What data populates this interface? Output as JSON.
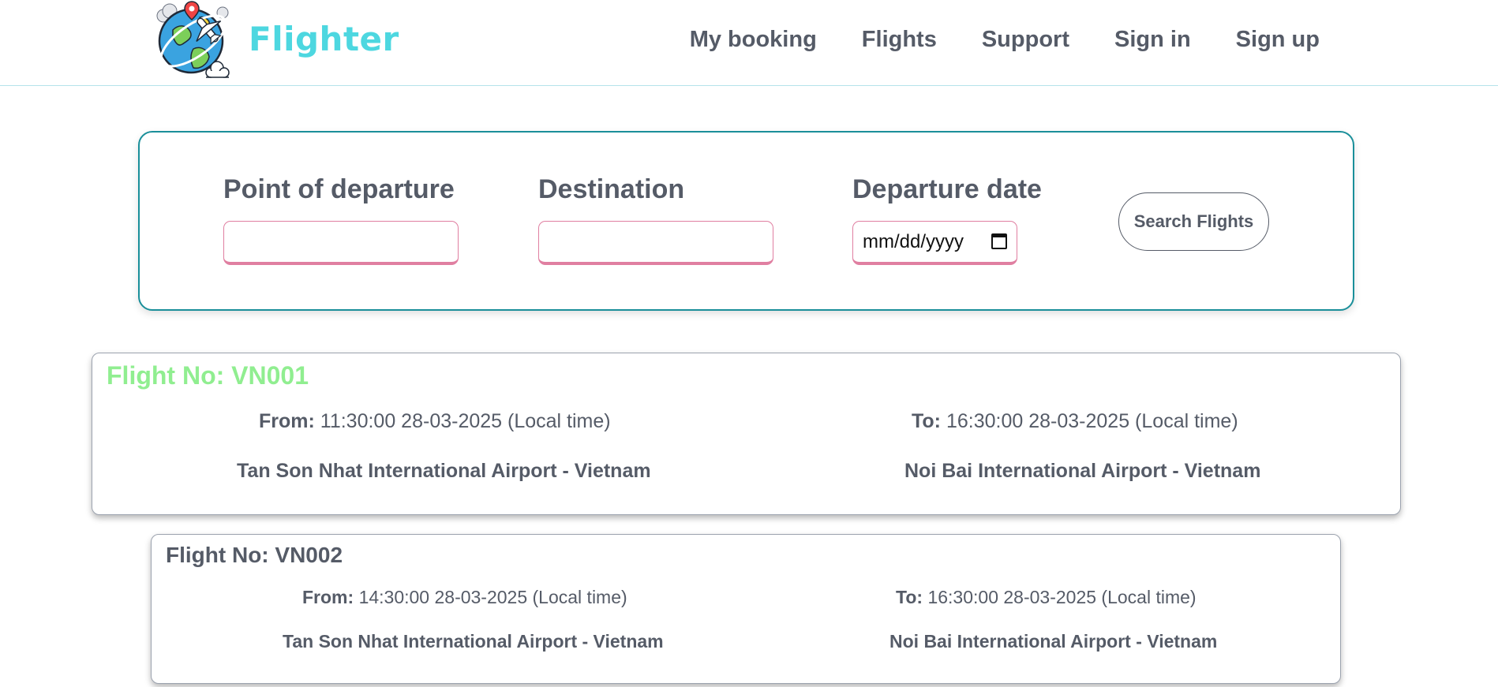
{
  "brand": {
    "name": "Flighter",
    "logo_icon": "globe-airplane-icon",
    "accent_color": "#4dd7e0"
  },
  "nav": {
    "items": [
      {
        "label": "My booking"
      },
      {
        "label": "Flights"
      },
      {
        "label": "Support"
      },
      {
        "label": "Sign in"
      },
      {
        "label": "Sign up"
      }
    ]
  },
  "search": {
    "departure_label": "Point of departure",
    "departure_value": "",
    "destination_label": "Destination",
    "destination_value": "",
    "date_label": "Departure date",
    "date_placeholder": "mm/dd/yyyy",
    "date_icon": "calendar-icon",
    "button_label": "Search Flights",
    "panel_border_color": "#1a8f9a",
    "input_border_color": "#e07fa1"
  },
  "flights": [
    {
      "flight_no": "Flight No: VN001",
      "flight_no_color": "#90ee90",
      "from_label": "From:",
      "from_time": "11:30:00 28-03-2025 (Local time)",
      "to_label": "To:",
      "to_time": "16:30:00 28-03-2025 (Local time)",
      "from_airport": "Tan Son Nhat International Airport - Vietnam",
      "to_airport": "Noi Bai International Airport - Vietnam"
    },
    {
      "flight_no": "Flight No: VN002",
      "flight_no_color": "#555b67",
      "from_label": "From:",
      "from_time": "14:30:00 28-03-2025 (Local time)",
      "to_label": "To:",
      "to_time": "16:30:00 28-03-2025 (Local time)",
      "from_airport": "Tan Son Nhat International Airport - Vietnam",
      "to_airport": "Noi Bai International Airport - Vietnam"
    }
  ]
}
